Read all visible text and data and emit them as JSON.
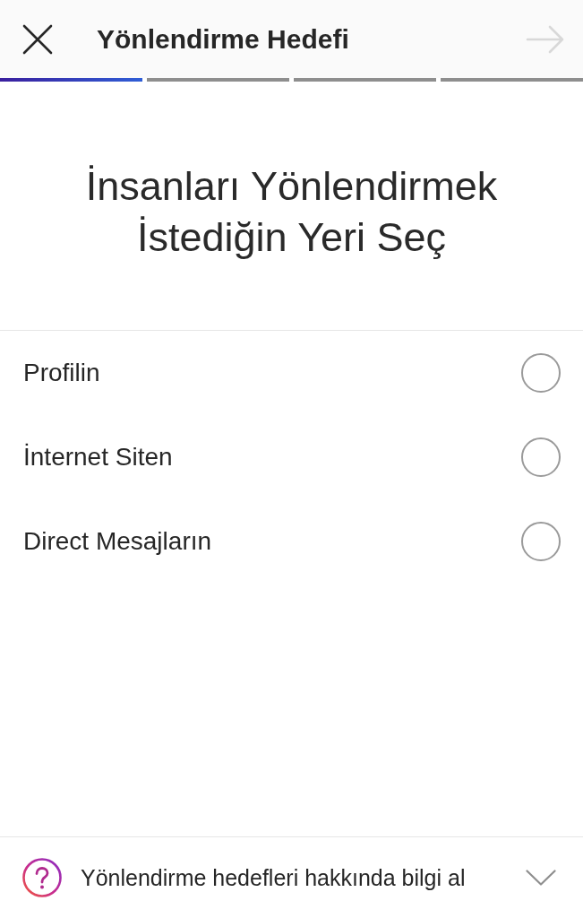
{
  "header": {
    "title": "Yönlendirme Hedefi",
    "next_button": {
      "disabled": true
    }
  },
  "steps": [
    {
      "selected": true
    },
    {
      "selected": false
    },
    {
      "selected": false
    },
    {
      "selected": false
    }
  ],
  "heading": "İnsanları Yönlendirmek İstediğin Yeri Seç",
  "options": [
    {
      "label": "Profilin",
      "selected": false
    },
    {
      "label": "İnternet Siten",
      "selected": false
    },
    {
      "label": "Direct Mesajların",
      "selected": false
    }
  ],
  "footer": {
    "label": "Yönlendirme hedefleri hakkında bilgi al",
    "expanded": false
  }
}
